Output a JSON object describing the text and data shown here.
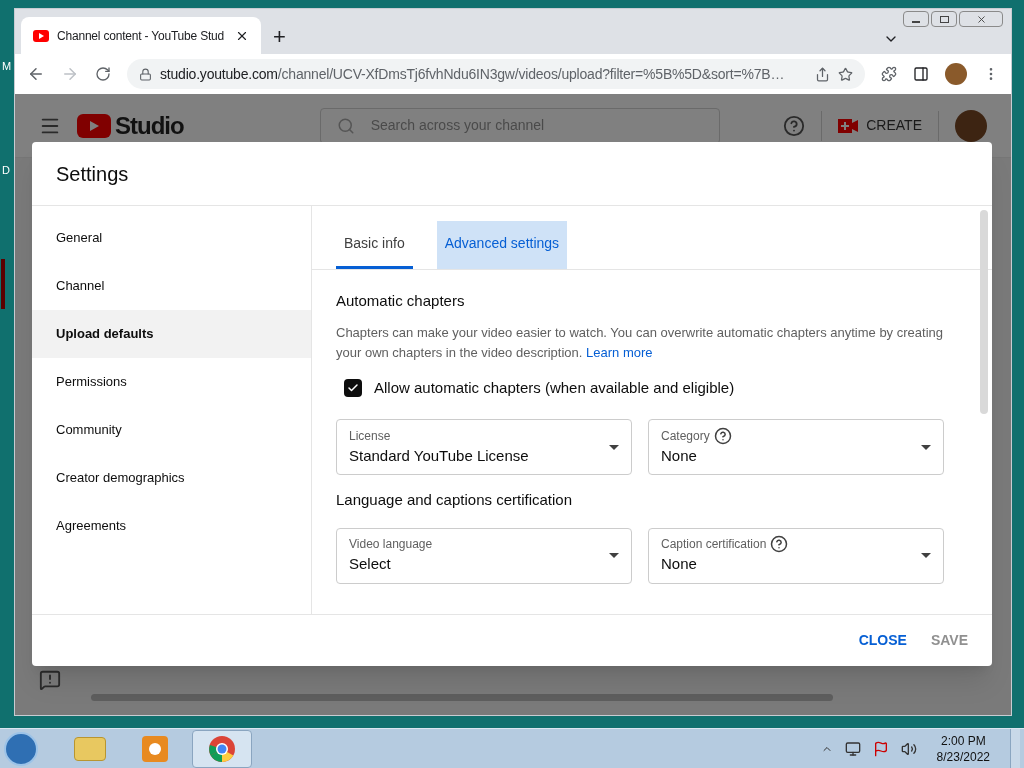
{
  "desktop_labels": [
    "M",
    "D"
  ],
  "browser": {
    "tab_title": "Channel content - YouTube Stud",
    "new_tab": "+",
    "url_host": "studio.youtube.com",
    "url_path": "/channel/UCV-XfDmsTj6fvhNdu6IN3gw/videos/upload?filter=%5B%5D&sort=%7B…"
  },
  "studio_header": {
    "logo": "Studio",
    "search_placeholder": "Search across your channel",
    "create": "CREATE"
  },
  "dialog": {
    "title": "Settings",
    "nav": [
      {
        "label": "General",
        "selected": false
      },
      {
        "label": "Channel",
        "selected": false
      },
      {
        "label": "Upload defaults",
        "selected": true
      },
      {
        "label": "Permissions",
        "selected": false
      },
      {
        "label": "Community",
        "selected": false
      },
      {
        "label": "Creator demographics",
        "selected": false
      },
      {
        "label": "Agreements",
        "selected": false
      }
    ],
    "tabs": [
      {
        "label": "Basic info",
        "selected": true,
        "hovered": false
      },
      {
        "label": "Advanced settings",
        "selected": false,
        "hovered": true
      }
    ],
    "sections": [
      {
        "heading": "Automatic chapters",
        "description": "Chapters can make your video easier to watch. You can overwrite automatic chapters anytime by creating your own chapters in the video description.",
        "link": "Learn more",
        "checkbox": {
          "label": "Allow automatic chapters (when available and eligible)",
          "checked": true
        },
        "fields": [
          {
            "label": "License",
            "value": "Standard YouTube License",
            "help": false
          },
          {
            "label": "Category",
            "value": "None",
            "help": true
          }
        ]
      },
      {
        "heading": "Language and captions certification",
        "fields": [
          {
            "label": "Video language",
            "value": "Select",
            "help": false
          },
          {
            "label": "Caption certification",
            "value": "None",
            "help": true
          }
        ]
      }
    ],
    "buttons": [
      {
        "label": "CLOSE",
        "disabled": false
      },
      {
        "label": "SAVE",
        "disabled": true
      }
    ]
  },
  "taskbar": {
    "time": "2:00 PM",
    "date": "8/23/2022"
  }
}
